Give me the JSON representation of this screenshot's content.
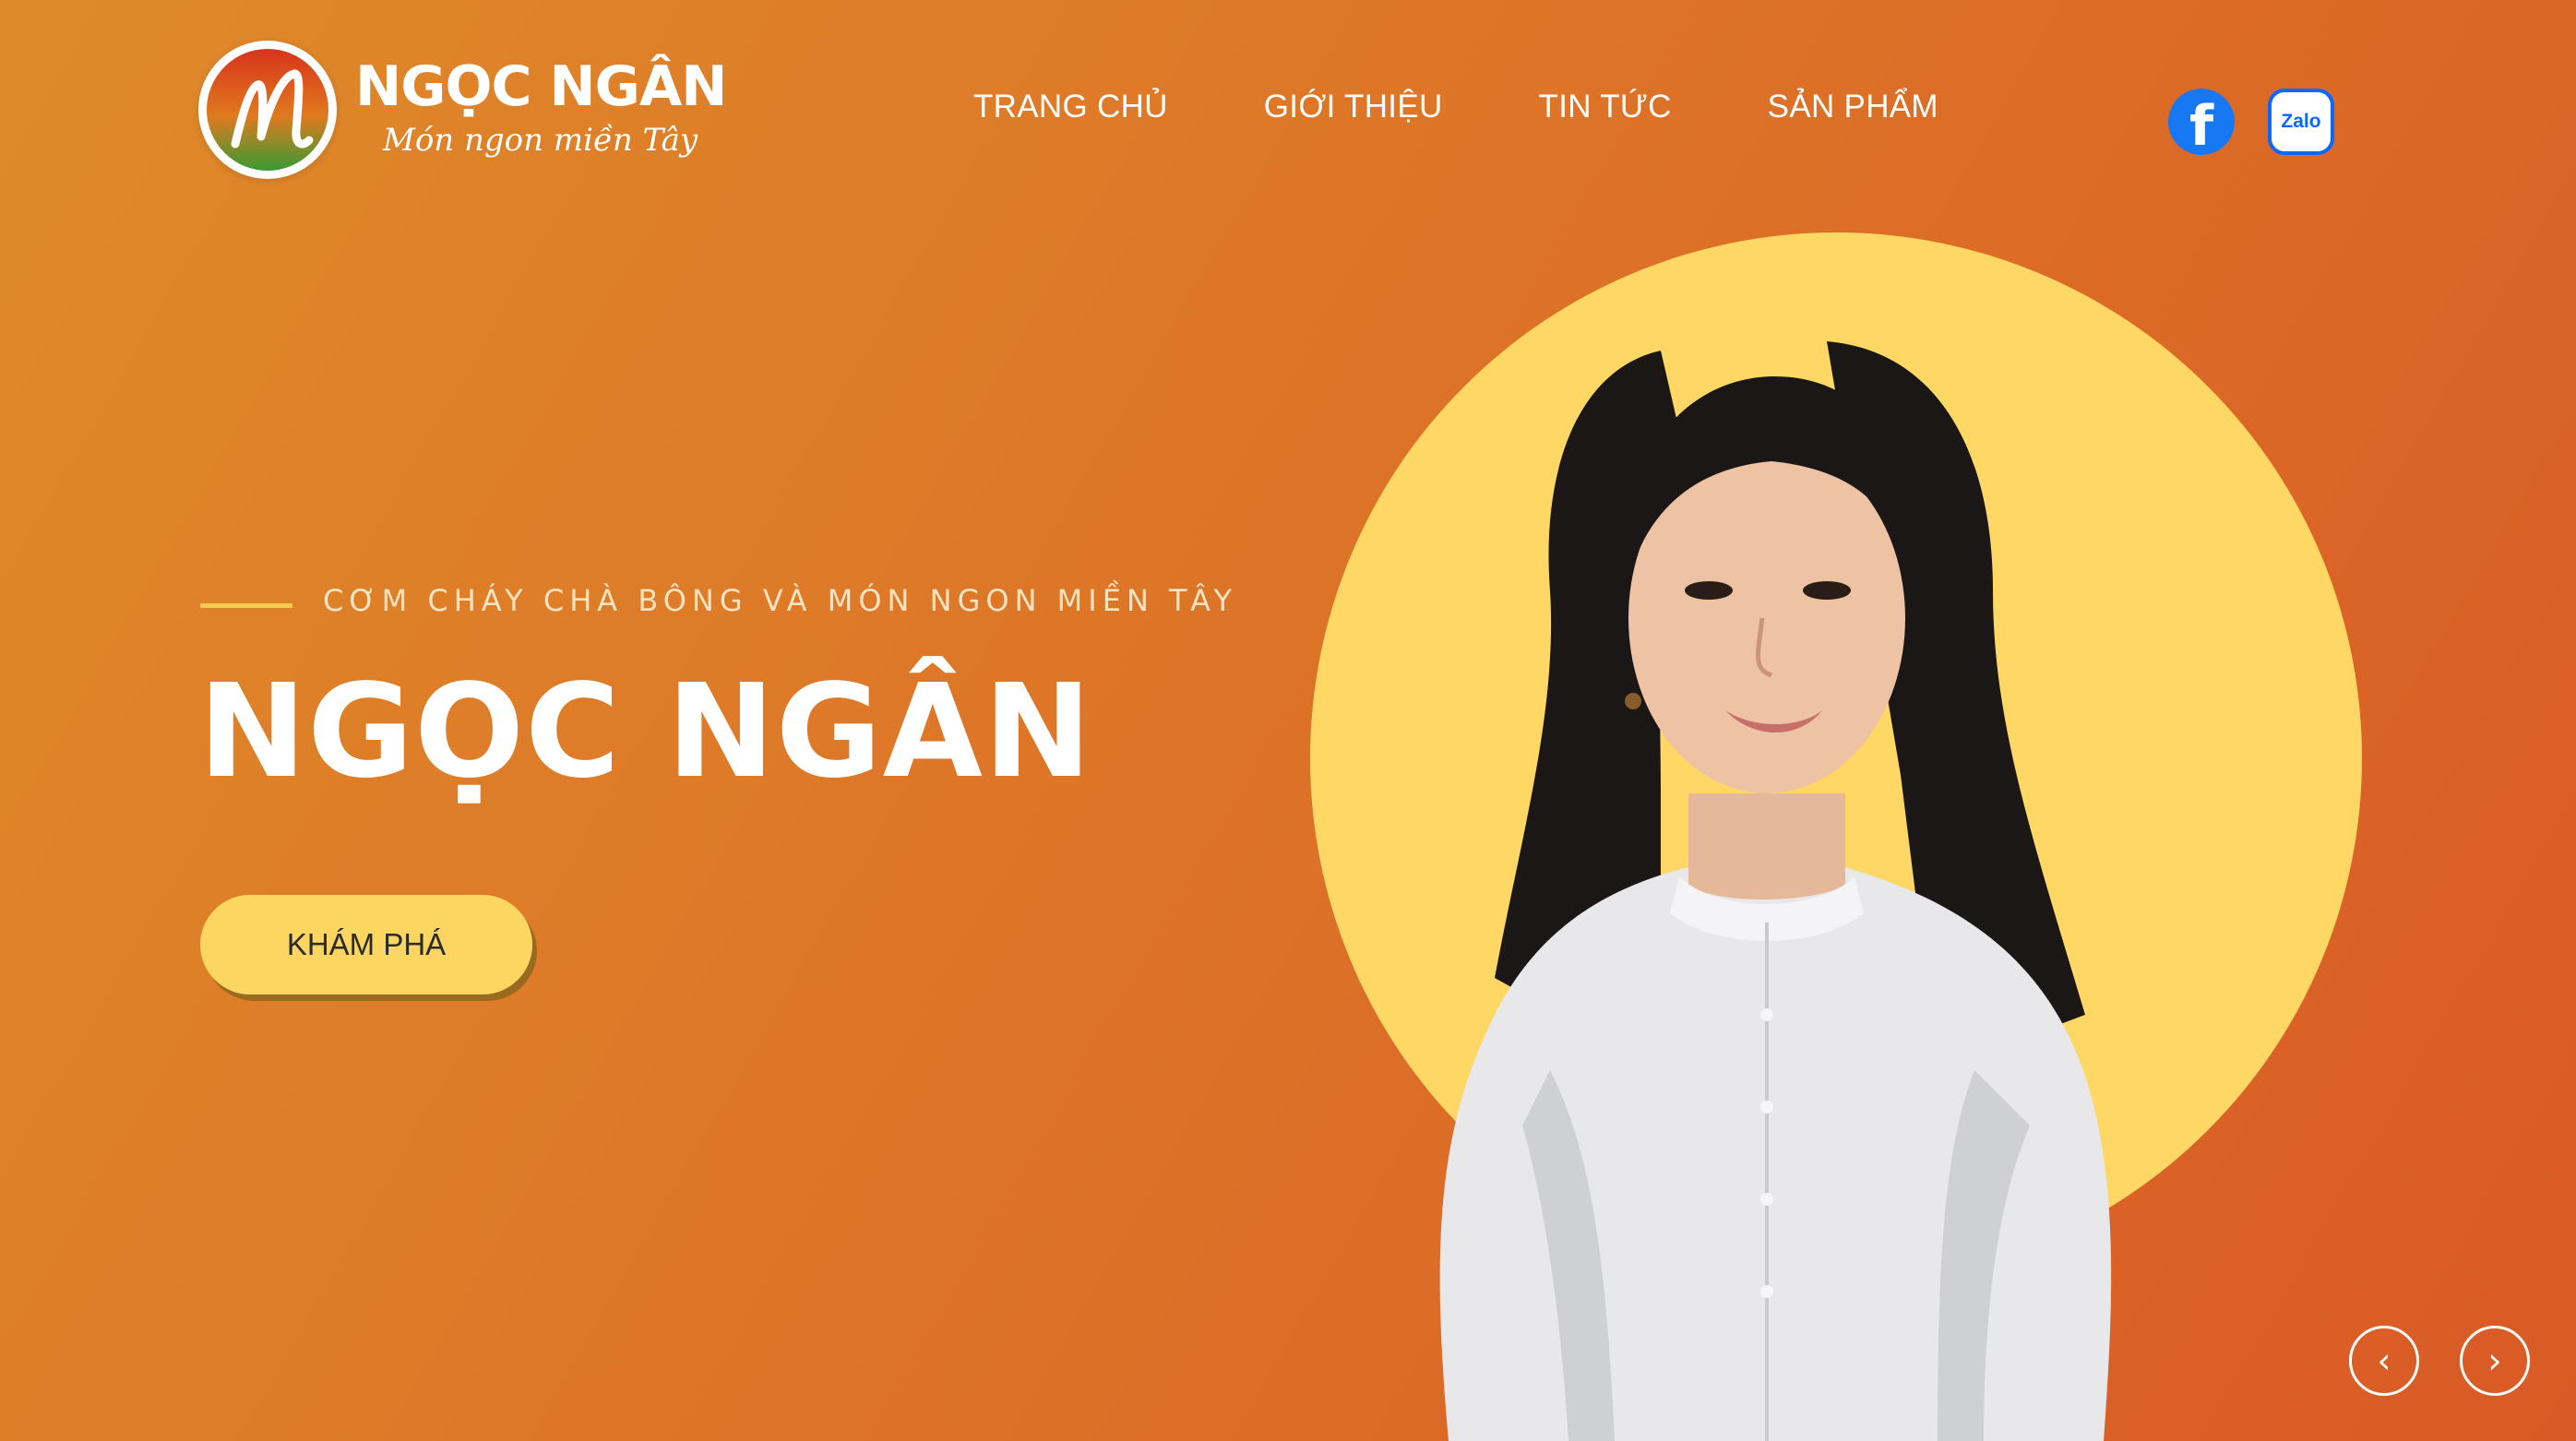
{
  "brand": {
    "name": "NGỌC NGÂN",
    "tagline": "Món ngon miền Tây",
    "colors": {
      "orange": "#dd7527",
      "yellow": "#fed764",
      "green": "#3a9a34",
      "red": "#d8331c"
    }
  },
  "nav": {
    "items": [
      {
        "label": "TRANG CHỦ"
      },
      {
        "label": "GIỚI THIỆU"
      },
      {
        "label": "TIN TỨC"
      },
      {
        "label": "SẢN PHẨM"
      }
    ]
  },
  "social": {
    "facebook": {
      "glyph": "f",
      "icon": "facebook-icon",
      "color": "#1877f2"
    },
    "zalo": {
      "label": "Zalo",
      "icon": "zalo-icon",
      "color": "#0a68ff"
    }
  },
  "hero": {
    "eyebrow": "CƠM CHÁY CHÀ BÔNG VÀ MÓN NGON MIỀN TÂY",
    "title": "NGỌC NGÂN",
    "cta_label": "KHÁM PHÁ"
  },
  "slider": {
    "prev_icon": "chevron-left-icon",
    "next_icon": "chevron-right-icon",
    "prev_glyph": "‹",
    "next_glyph": "›"
  }
}
